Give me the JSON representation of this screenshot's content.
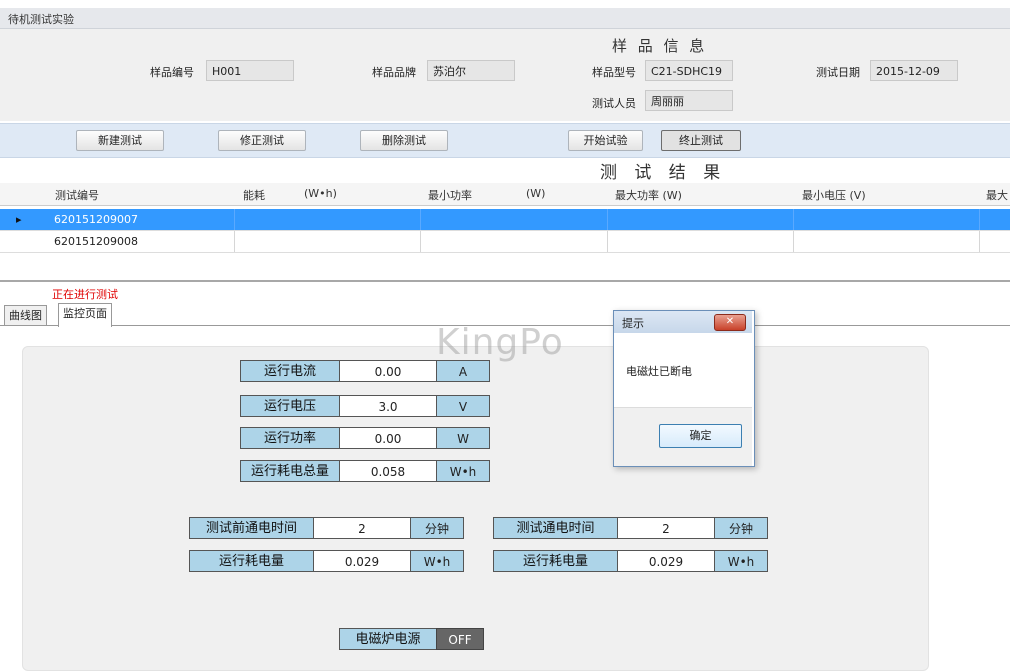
{
  "window": {
    "title": "待机测试实验"
  },
  "sample_info": {
    "heading": "样 品 信 息",
    "sample_no_label": "样品编号",
    "sample_no": "H001",
    "brand_label": "样品品牌",
    "brand": "苏泊尔",
    "model_label": "样品型号",
    "model": "C21-SDHC19",
    "date_label": "测试日期",
    "date": "2015-12-09",
    "tester_label": "测试人员",
    "tester": "周丽丽"
  },
  "toolbar": {
    "new_test": "新建测试",
    "modify_test": "修正测试",
    "delete_test": "删除测试",
    "start_test": "开始试验",
    "stop_test": "终止测试"
  },
  "results": {
    "heading": "测 试 结 果",
    "columns": [
      "测试编号",
      "能耗",
      "(W•h)",
      "最小功率",
      "(W)",
      "最大功率  (W)",
      "最小电压  (V)",
      "最大"
    ],
    "rows": [
      {
        "id": "620151209007"
      },
      {
        "id": "620151209008"
      }
    ]
  },
  "status_text": "正在进行测试",
  "tabs": [
    "曲线图",
    "监控页面"
  ],
  "watermark": "KingPo",
  "monitor": {
    "current": {
      "label": "运行电流",
      "value": "0.00",
      "unit": "A"
    },
    "voltage": {
      "label": "运行电压",
      "value": "3.0",
      "unit": "V"
    },
    "power": {
      "label": "运行功率",
      "value": "0.00",
      "unit": "W"
    },
    "energy_total": {
      "label": "运行耗电总量",
      "value": "0.058",
      "unit": "W•h"
    },
    "pre_time": {
      "label": "测试前通电时间",
      "value": "2",
      "unit": "分钟"
    },
    "pre_energy": {
      "label": "运行耗电量",
      "value": "0.029",
      "unit": "W•h"
    },
    "test_time": {
      "label": "测试通电时间",
      "value": "2",
      "unit": "分钟"
    },
    "test_energy": {
      "label": "运行耗电量",
      "value": "0.029",
      "unit": "W•h"
    },
    "power_source": {
      "label": "电磁炉电源",
      "state": "OFF"
    }
  },
  "dialog": {
    "title": "提示",
    "message": "电磁灶已断电",
    "ok": "确定",
    "close_glyph": "✕"
  }
}
